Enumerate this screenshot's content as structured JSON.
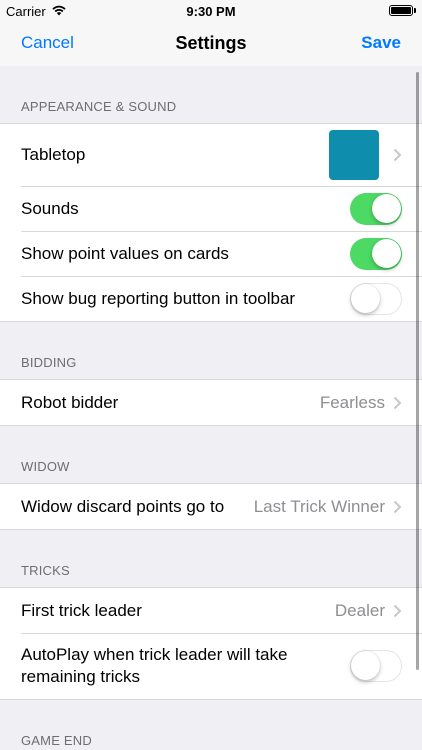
{
  "status_bar": {
    "carrier": "Carrier",
    "time": "9:30 PM"
  },
  "nav": {
    "cancel": "Cancel",
    "title": "Settings",
    "save": "Save"
  },
  "colors": {
    "tabletop": "#0e8dac",
    "accent": "#007aff",
    "toggle_on": "#4cd964"
  },
  "sections": {
    "appearance": {
      "header": "APPEARANCE & SOUND",
      "tabletop": "Tabletop",
      "sounds": "Sounds",
      "sounds_on": true,
      "point_values": "Show point values on cards",
      "point_values_on": true,
      "bug_button": "Show bug reporting button in toolbar",
      "bug_button_on": false
    },
    "bidding": {
      "header": "BIDDING",
      "robot_label": "Robot bidder",
      "robot_value": "Fearless"
    },
    "widow": {
      "header": "WIDOW",
      "discard_label": "Widow discard points go to",
      "discard_value": "Last Trick Winner"
    },
    "tricks": {
      "header": "TRICKS",
      "leader_label": "First trick leader",
      "leader_value": "Dealer",
      "autoplay_line1": "AutoPlay when trick leader will take",
      "autoplay_line2": "remaining tricks",
      "autoplay_on": false
    },
    "game_end": {
      "header": "GAME END"
    }
  }
}
